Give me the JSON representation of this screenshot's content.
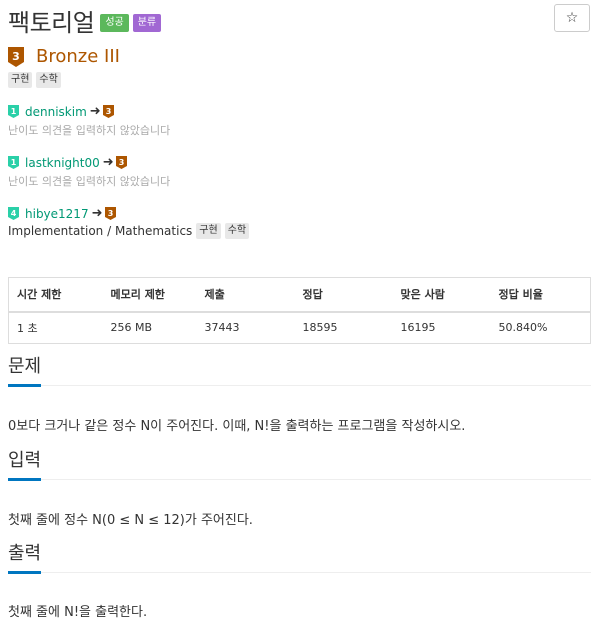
{
  "problem": {
    "title": "팩토리얼",
    "labels": {
      "success": "성공",
      "category": "분류"
    },
    "star_icon": "☆",
    "tier": {
      "badge_number": "3",
      "name": "Bronze III",
      "color": "#ad5600"
    },
    "tags": [
      "구현",
      "수학"
    ]
  },
  "contributions": [
    {
      "from_badge": "1",
      "from_color": "#2ad0a8",
      "user": "denniskim",
      "arrow": "➜",
      "to_badge": "3",
      "note": "난이도 의견을 입력하지 않았습니다"
    },
    {
      "from_badge": "1",
      "from_color": "#2ad0a8",
      "user": "lastknight00",
      "arrow": "➜",
      "to_badge": "3",
      "note": "난이도 의견을 입력하지 않았습니다"
    },
    {
      "from_badge": "4",
      "from_color": "#2ad0a8",
      "user": "hibye1217",
      "arrow": "➜",
      "to_badge": "3",
      "desc": "Implementation / Mathematics",
      "tags": [
        "구현",
        "수학"
      ]
    }
  ],
  "stats": {
    "headers": [
      "시간 제한",
      "메모리 제한",
      "제출",
      "정답",
      "맞은 사람",
      "정답 비율"
    ],
    "values": [
      "1 초",
      "256 MB",
      "37443",
      "18595",
      "16195",
      "50.840%"
    ]
  },
  "sections": {
    "problem": {
      "title": "문제",
      "text": "0보다 크거나 같은 정수 N이 주어진다. 이때, N!을 출력하는 프로그램을 작성하시오."
    },
    "input": {
      "title": "입력",
      "text": "첫째 줄에 정수 N(0 ≤ N ≤ 12)가 주어진다."
    },
    "output": {
      "title": "출력",
      "text": "첫째 줄에 N!을 출력한다."
    }
  }
}
